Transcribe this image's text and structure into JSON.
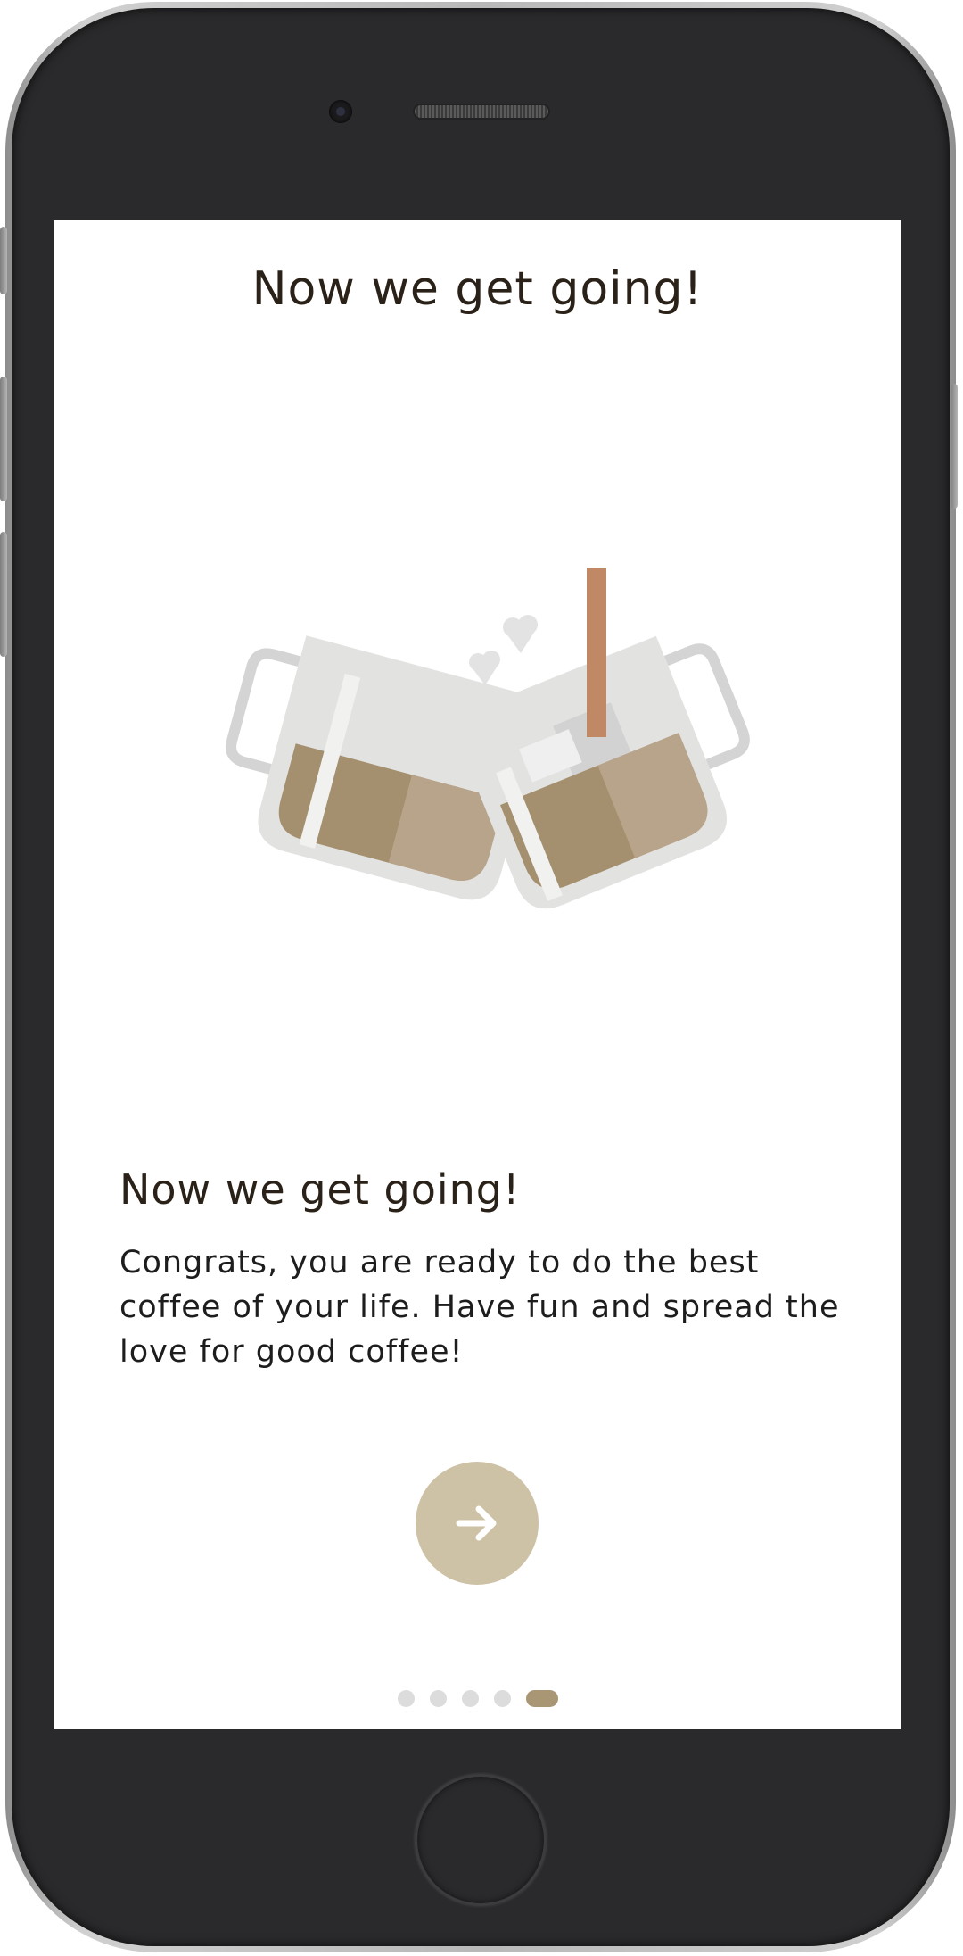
{
  "screen": {
    "header_title": "Now we get going!",
    "heading": "Now we get going!",
    "body": "Congrats, you are ready to do the best coffee of your life. Have fun and spread the love for good coffee!",
    "next_button_icon": "arrow-right-icon",
    "illustration": "two-coffee-mugs-toasting-illustration"
  },
  "pagination": {
    "total": 5,
    "active_index": 4
  },
  "colors": {
    "accent": "#cdc1a6",
    "active_dot": "#a89675",
    "inactive_dot": "#dcdcdc",
    "text_dark": "#2a2218",
    "coffee_dark": "#a48f6e",
    "coffee_light": "#b8a48a",
    "straw": "#c08865",
    "glass": "#e2e3e1"
  }
}
